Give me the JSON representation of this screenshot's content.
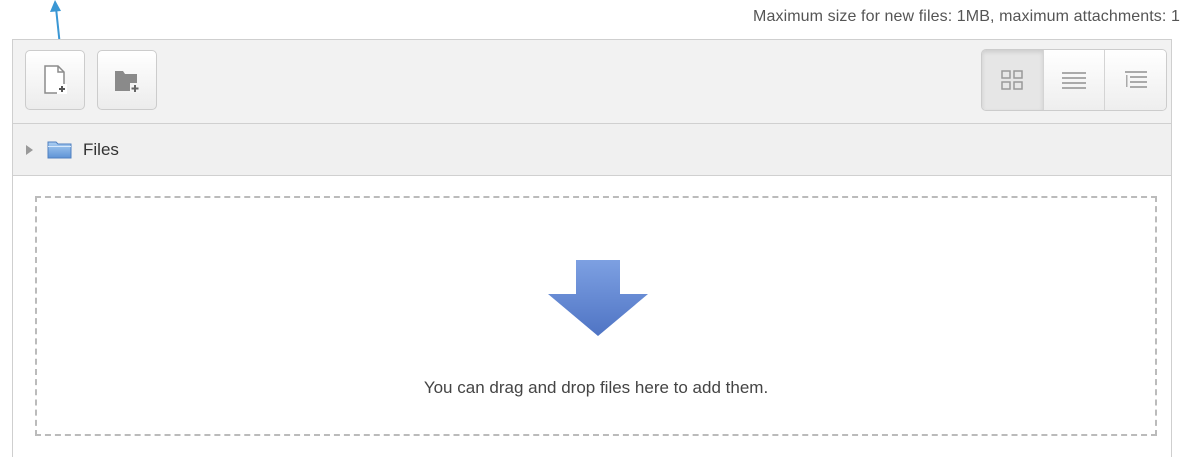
{
  "restrictions_text": "Maximum size for new files: 1MB, maximum attachments: 1",
  "toolbar": {
    "add_icon": "add-file-icon",
    "create_folder_icon": "create-folder-icon",
    "views": [
      "view-icons-icon",
      "view-details-icon",
      "view-tree-icon"
    ],
    "active_view": "view-icons-icon"
  },
  "path": {
    "folder_label": "Files"
  },
  "dropzone": {
    "message": "You can drag and drop files here to add them.",
    "icon": "down-arrow-icon"
  },
  "colors": {
    "annotation_arrow": "#3a97d4",
    "drop_arrow": "#5b82cf"
  }
}
